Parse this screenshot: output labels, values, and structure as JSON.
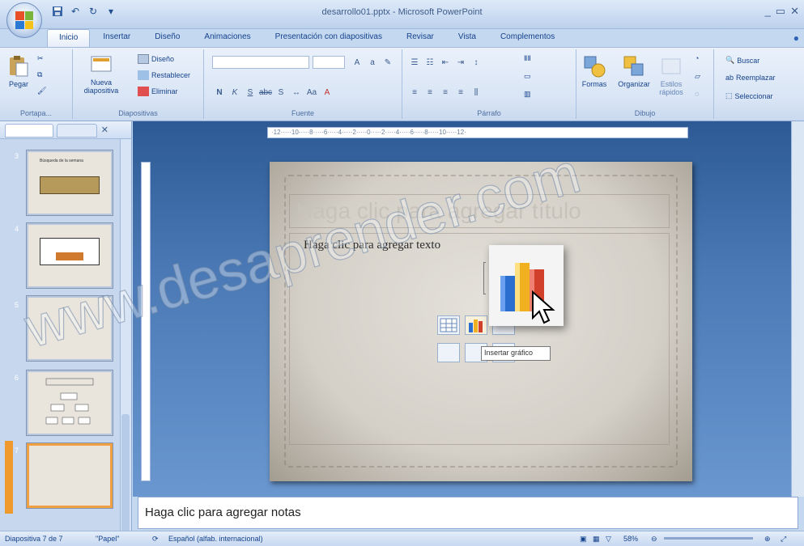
{
  "window": {
    "title": "desarrollo01.pptx - Microsoft PowerPoint",
    "controls": [
      "_",
      "▭",
      "✕"
    ]
  },
  "ribbon_tabs": [
    "Inicio",
    "Insertar",
    "Diseño",
    "Animaciones",
    "Presentación con diapositivas",
    "Revisar",
    "Vista",
    "Complementos"
  ],
  "active_tab": "Inicio",
  "groups": {
    "portapapeles": {
      "label": "Portapa...",
      "pegar": "Pegar"
    },
    "diapositivas": {
      "label": "Diapositivas",
      "nueva": "Nueva diapositiva",
      "diseno": "Diseño",
      "restablecer": "Restablecer",
      "eliminar": "Eliminar"
    },
    "fuente": {
      "label": "Fuente",
      "bold": "N",
      "italic": "K",
      "underline": "S",
      "strike": "abc",
      "shadow": "S"
    },
    "parrafo": {
      "label": "Párrafo"
    },
    "dibujo": {
      "label": "Dibujo",
      "formas": "Formas",
      "organizar": "Organizar",
      "estilos": "Estilos rápidos"
    },
    "edicion": {
      "buscar": "Buscar",
      "reemplazar": "Reemplazar",
      "seleccionar": "Seleccionar"
    }
  },
  "slides_panel": {
    "numbers": [
      "3",
      "4",
      "5",
      "6",
      "7"
    ],
    "thumb1_title": "Búsqueda de la semana"
  },
  "slide": {
    "title_placeholder": "Haga clic para agregar título",
    "body_placeholder": "Haga clic para agregar texto"
  },
  "tooltip": "Insertar gráfico",
  "notes": "Haga clic para agregar notas",
  "status": {
    "slide": "Diapositiva 7 de 7",
    "theme": "\"Papel\"",
    "language": "Español (alfab. internacional)",
    "zoom": "58%"
  },
  "watermark": "www.desaprender.com",
  "ruler": "·12·····10·····8·····6·····4·····2·····0·····2·····4·····6·····8·····10·····12·"
}
